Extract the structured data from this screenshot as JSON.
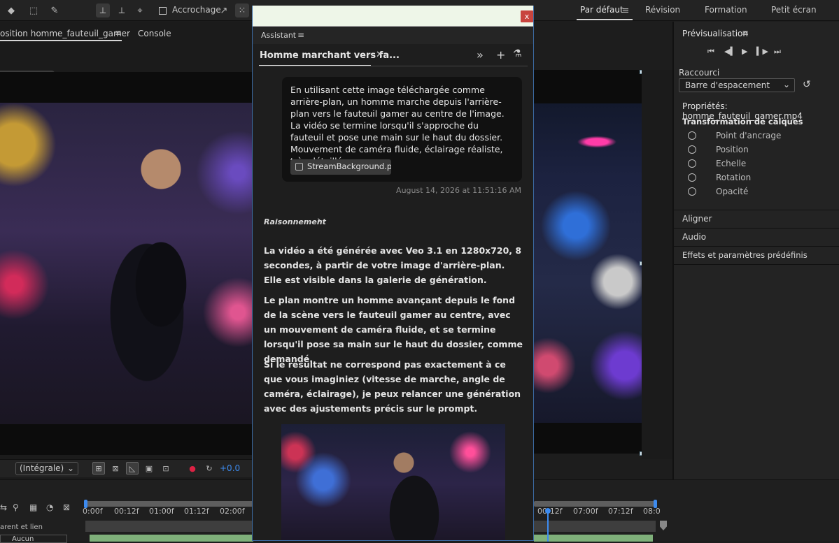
{
  "toolbar": {
    "snap_label": "Accrochage",
    "workspaces": [
      "Par défaut",
      "Révision",
      "Formation",
      "Petit écran"
    ],
    "active_workspace": "Par défaut"
  },
  "comp_panel": {
    "tab_label": "osition homme_fauteuil_gamer",
    "console_label": "Console",
    "comp_chip": "euil_gamer"
  },
  "comp_controls": {
    "resolution": "(Intégrale)",
    "exposure": "+0.0"
  },
  "timeline": {
    "ticks": [
      "0:00f",
      "00:12f",
      "01:00f",
      "01:12f",
      "02:00f",
      "00:12f",
      "07:00f",
      "07:12f",
      "08:0"
    ],
    "parent_label": "arent et lien",
    "parent_value": "Aucun"
  },
  "assistant": {
    "header_label": "Assistant",
    "tab_title": "Homme marchant vers fa...",
    "close_label": "x",
    "user_message": "En utilisant cette image téléchargée comme arrière-plan, un homme marche depuis l'arrière-plan vers le fauteuil gamer au centre de l'image. La vidéo se termine lorsqu'il s'approche du fauteuil et pose une main sur le haut du dossier. Mouvement de caméra fluide, éclairage réaliste, très détaillé.",
    "attachment": "StreamBackground.p...",
    "timestamp": "August 14, 2026 at 11:51:16 AM",
    "reasoning_label": "Raisonnement",
    "responses": [
      "La vidéo a été générée avec Veo 3.1 en 1280x720, 8 secondes, à partir de votre image d'arrière-plan. Elle est visible dans la galerie de génération.",
      "Le plan montre un homme avançant depuis le fond de la scène vers le fauteuil gamer au centre, avec un mouvement de caméra fluide, et se termine lorsqu'il pose sa main sur le haut du dossier, comme demandé.",
      "Si le résultat ne correspond pas exactement à ce que vous imaginiez (vitesse de marche, angle de caméra, éclairage), je peux relancer une génération avec des ajustements précis sur le prompt."
    ]
  },
  "props": {
    "preview_title": "Prévisualisation",
    "shortcut_label": "Raccourci",
    "shortcut_value": "Barre d'espacement",
    "properties_title": "Propriétés: homme_fauteuil_gamer.mp4",
    "transform_title": "Transformation de calques",
    "transform_rows": [
      "Point d'ancrage",
      "Position",
      "Echelle",
      "Rotation",
      "Opacité"
    ],
    "sections": [
      "Aligner",
      "Audio",
      "Effets et paramètres prédéfinis"
    ]
  },
  "colors": {
    "accent_blue": "#3d8bef",
    "close_red": "#c8443e",
    "titlebar_green": "#eef6e8"
  }
}
